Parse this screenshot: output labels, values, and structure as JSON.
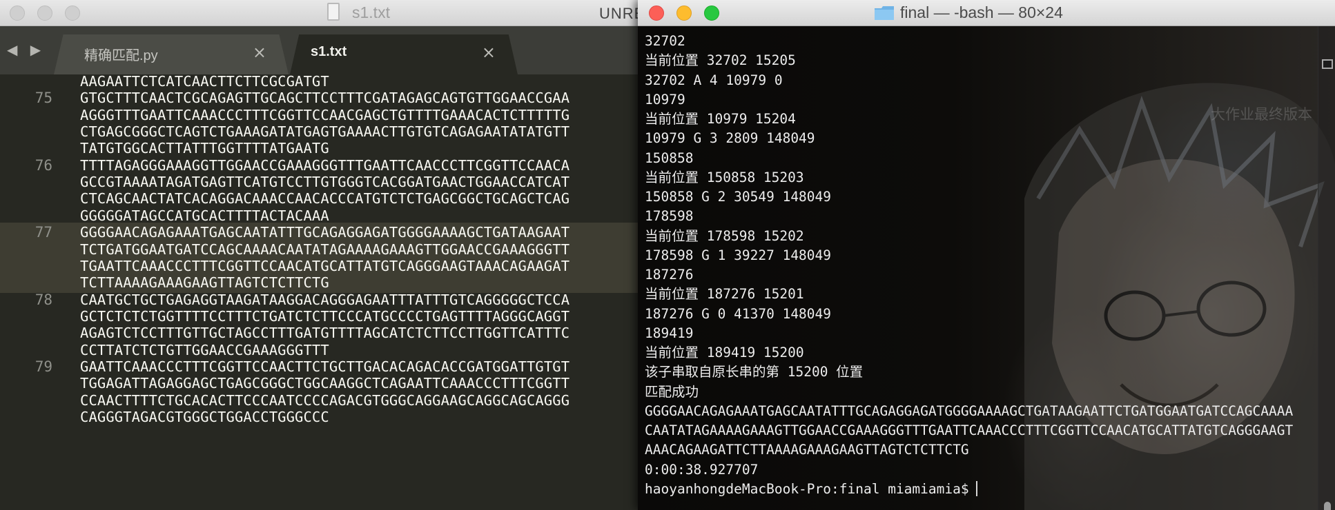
{
  "editor": {
    "window_title": "s1.txt",
    "unregistered_label": "UNRE",
    "tabs": [
      {
        "label": "精确匹配.py",
        "close": "×"
      },
      {
        "label": "s1.txt",
        "close": "×"
      }
    ],
    "nav_arrows": "◀ ▶",
    "lines": [
      {
        "ln": "",
        "text": "AAGAATTCTCATCAACTTCTTCGCGATGT"
      },
      {
        "ln": "75",
        "text": "GTGCTTTCAACTCGCAGAGTTGCAGCTTCCTTTCGATAGAGCAGTGTTGGAACCGAA"
      },
      {
        "ln": "",
        "text": "AGGGTTTGAATTCAAACCCTTTCGGTTCCAACGAGCTGTTTTGAAACACTCTTTTTG"
      },
      {
        "ln": "",
        "text": "CTGAGCGGGCTCAGTCTGAAAGATATGAGTGAAAACTTGTGTCAGAGAATATATGTT"
      },
      {
        "ln": "",
        "text": "TATGTGGCACTTATTTGGTTTTATGAATG"
      },
      {
        "ln": "76",
        "text": "TTTTAGAGGGAAAGGTTGGAACCGAAAGGGTTTGAATTCAACCCTTCGGTTCCAACA"
      },
      {
        "ln": "",
        "text": "GCCGTAAAATAGATGAGTTCATGTCCTTGTGGGTCACGGATGAACTGGAACCATCAT"
      },
      {
        "ln": "",
        "text": "CTCAGCAACTATCACAGGACAAACCAACACCCATGTCTCTGAGCGGCTGCAGCTCAG"
      },
      {
        "ln": "",
        "text": "GGGGGATAGCCATGCACTTTTACTACAAA"
      },
      {
        "ln": "77",
        "text": "GGGGAACAGAGAAATGAGCAATATTTGCAGAGGAGATGGGGAAAAGCTGATAAGAAT"
      },
      {
        "ln": "",
        "text": "TCTGATGGAATGATCCAGCAAAACAATATAGAAAAGAAAGTTGGAACCGAAAGGGTT"
      },
      {
        "ln": "",
        "text": "TGAATTCAAACCCTTTCGGTTCCAACATGCATTATGTCAGGGAAGTAAACAGAAGAT"
      },
      {
        "ln": "",
        "text": "TCTTAAAAGAAAGAAGTTAGTCTCTTCTG"
      },
      {
        "ln": "78",
        "text": "CAATGCTGCTGAGAGGTAAGATAAGGACAGGGAGAATTTATTTGTCAGGGGGCTCCA"
      },
      {
        "ln": "",
        "text": "GCTCTCTCTGGTTTTCCTTTCTGATCTCTTCCCATGCCCCTGAGTTTTAGGGCAGGT"
      },
      {
        "ln": "",
        "text": "AGAGTCTCCTTTGTTGCTAGCCTTTGATGTTTTAGCATCTCTTCCTTGGTTCATTTC"
      },
      {
        "ln": "",
        "text": "CCTTATCTCTGTTGGAACCGAAAGGGTTT"
      },
      {
        "ln": "79",
        "text": "GAATTCAAACCCTTTCGGTTCCAACTTCTGCTTGACACAGACACCGATGGATTGTGT"
      },
      {
        "ln": "",
        "text": "TGGAGATTAGAGGAGCTGAGCGGGCTGGCAAGGCTCAGAATTCAAACCCTTTCGGTT"
      },
      {
        "ln": "",
        "text": "CCAACTTTTCTGCACACTTCCCAATCCCCAGACGTGGGCAGGAAGCAGGCAGCAGGG"
      },
      {
        "ln": "",
        "text": "CAGGGTAGACGTGGGCTGGACCTGGGCCC"
      }
    ]
  },
  "terminal": {
    "window_title": "final — -bash — 80×24",
    "lines": [
      "32702",
      "当前位置 32702 15205",
      "32702 A 4 10979 0",
      "10979",
      "当前位置 10979 15204",
      "10979 G 3 2809 148049",
      "150858",
      "当前位置 150858 15203",
      "150858 G 2 30549 148049",
      "178598",
      "当前位置 178598 15202",
      "178598 G 1 39227 148049",
      "187276",
      "当前位置 187276 15201",
      "187276 G 0 41370 148049",
      "189419",
      "当前位置 189419 15200",
      "该子串取自原长串的第 15200 位置",
      "匹配成功",
      "GGGGAACAGAGAAATGAGCAATATTTGCAGAGGAGATGGGGAAAAGCTGATAAGAATTCTGATGGAATGATCCAGCAAAA",
      "CAATATAGAAAAGAAAGTTGGAACCGAAAGGGTTTGAATTCAAACCCTTTCGGTTCCAACATGCATTATGTCAGGGAAGT",
      "AAACAGAAGATTCTTAAAAGAAAGAAGTTAGTCTCTTCTG",
      "0:00:38.927707",
      "haoyanhongdeMacBook-Pro:final miamiamia$"
    ],
    "background_caption": "大作业最终版本"
  },
  "colors": {
    "editor_bg": "#272822",
    "editor_highlight": "#3e3d32",
    "terminal_bg": "#0b0a08",
    "close": "#fc5f57",
    "minimize": "#fdbc2e",
    "maximize": "#28c840"
  },
  "icons": [
    "file-icon",
    "folder-icon",
    "close-icon",
    "minimize-icon",
    "maximize-icon",
    "tab-close-icon",
    "nav-back-icon",
    "nav-forward-icon"
  ]
}
